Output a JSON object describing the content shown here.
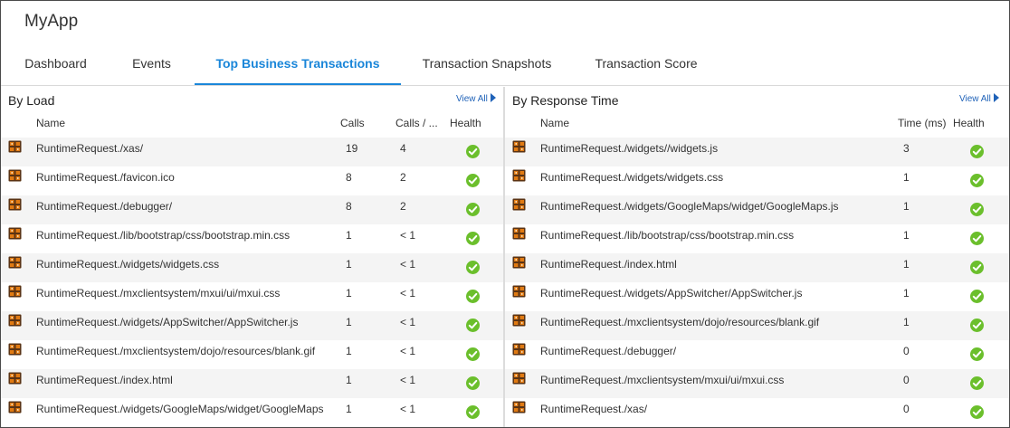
{
  "app": {
    "title": "MyApp"
  },
  "tabs": [
    {
      "label": "Dashboard"
    },
    {
      "label": "Events"
    },
    {
      "label": "Top Business Transactions"
    },
    {
      "label": "Transaction Snapshots"
    },
    {
      "label": "Transaction Score"
    }
  ],
  "by_load": {
    "title": "By Load",
    "view_all": "View All",
    "columns": {
      "name": "Name",
      "calls": "Calls",
      "calls_per": "Calls / ...",
      "health": "Health"
    },
    "rows": [
      {
        "name": "RuntimeRequest./xas/",
        "calls": "19",
        "calls_per": "4",
        "health": "healthy"
      },
      {
        "name": "RuntimeRequest./favicon.ico",
        "calls": "8",
        "calls_per": "2",
        "health": "healthy"
      },
      {
        "name": "RuntimeRequest./debugger/",
        "calls": "8",
        "calls_per": "2",
        "health": "healthy"
      },
      {
        "name": "RuntimeRequest./lib/bootstrap/css/bootstrap.min.css",
        "calls": "1",
        "calls_per": "< 1",
        "health": "healthy"
      },
      {
        "name": "RuntimeRequest./widgets/widgets.css",
        "calls": "1",
        "calls_per": "< 1",
        "health": "healthy"
      },
      {
        "name": "RuntimeRequest./mxclientsystem/mxui/ui/mxui.css",
        "calls": "1",
        "calls_per": "< 1",
        "health": "healthy"
      },
      {
        "name": "RuntimeRequest./widgets/AppSwitcher/AppSwitcher.js",
        "calls": "1",
        "calls_per": "< 1",
        "health": "healthy"
      },
      {
        "name": "RuntimeRequest./mxclientsystem/dojo/resources/blank.gif",
        "calls": "1",
        "calls_per": "< 1",
        "health": "healthy"
      },
      {
        "name": "RuntimeRequest./index.html",
        "calls": "1",
        "calls_per": "< 1",
        "health": "healthy"
      },
      {
        "name": "RuntimeRequest./widgets/GoogleMaps/widget/GoogleMaps",
        "calls": "1",
        "calls_per": "< 1",
        "health": "healthy"
      }
    ]
  },
  "by_response_time": {
    "title": "By Response Time",
    "view_all": "View All",
    "columns": {
      "name": "Name",
      "time": "Time (ms)",
      "health": "Health"
    },
    "rows": [
      {
        "name": "RuntimeRequest./widgets//widgets.js",
        "time": "3",
        "health": "healthy"
      },
      {
        "name": "RuntimeRequest./widgets/widgets.css",
        "time": "1",
        "health": "healthy"
      },
      {
        "name": "RuntimeRequest./widgets/GoogleMaps/widget/GoogleMaps.js",
        "time": "1",
        "health": "healthy"
      },
      {
        "name": "RuntimeRequest./lib/bootstrap/css/bootstrap.min.css",
        "time": "1",
        "health": "healthy"
      },
      {
        "name": "RuntimeRequest./index.html",
        "time": "1",
        "health": "healthy"
      },
      {
        "name": "RuntimeRequest./widgets/AppSwitcher/AppSwitcher.js",
        "time": "1",
        "health": "healthy"
      },
      {
        "name": "RuntimeRequest./mxclientsystem/dojo/resources/blank.gif",
        "time": "1",
        "health": "healthy"
      },
      {
        "name": "RuntimeRequest./debugger/",
        "time": "0",
        "health": "healthy"
      },
      {
        "name": "RuntimeRequest./mxclientsystem/mxui/ui/mxui.css",
        "time": "0",
        "health": "healthy"
      },
      {
        "name": "RuntimeRequest./xas/",
        "time": "0",
        "health": "healthy"
      }
    ]
  },
  "icons": {
    "transaction": "business-transaction-icon",
    "health": "health-ok-icon",
    "view_all_arrow": "caret-right-icon"
  },
  "colors": {
    "accent": "#1a86d9",
    "link": "#1f62b8",
    "health_ok": "#6bbf2c",
    "icon_orange": "#e07a12",
    "icon_dark": "#5a3314",
    "row_stripe": "#f4f4f4"
  }
}
